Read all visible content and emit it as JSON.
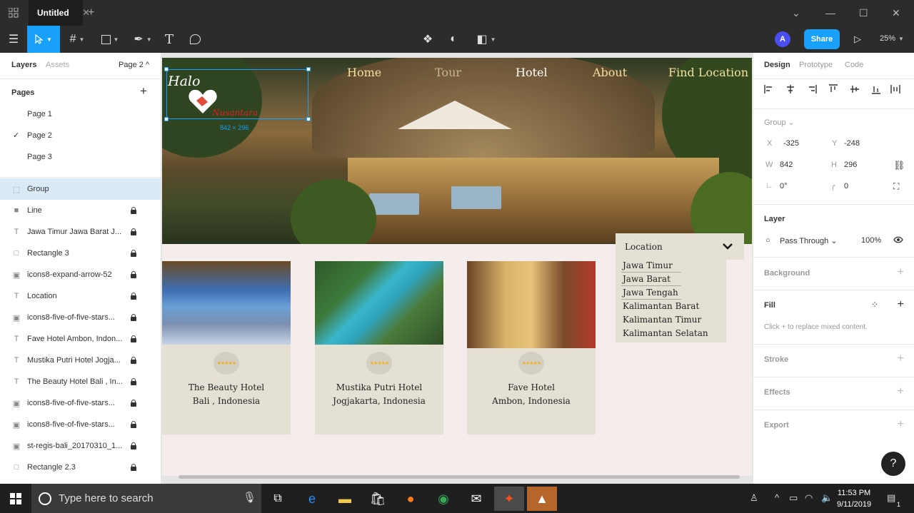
{
  "titlebar": {
    "tab_title": "Untitled",
    "close_glyph": "✕",
    "new_tab_glyph": "+"
  },
  "toolbar": {
    "avatar_initial": "A",
    "share_label": "Share",
    "zoom": "25%"
  },
  "left_panel": {
    "tabs": {
      "layers": "Layers",
      "assets": "Assets",
      "page_selector": "Page 2 ^"
    },
    "pages_title": "Pages",
    "add_glyph": "+",
    "pages": [
      "Page 1",
      "Page 2",
      "Page 3"
    ],
    "selected_page_mark": "✓",
    "layers": [
      {
        "name": "Group",
        "icon": "group-icon",
        "locked": false,
        "selected": true
      },
      {
        "name": "Line",
        "icon": "line-icon",
        "locked": true
      },
      {
        "name": "Jawa Timur Jawa Barat J...",
        "icon": "text-icon",
        "locked": true
      },
      {
        "name": "Rectangle 3",
        "icon": "rectangle-icon",
        "locked": true
      },
      {
        "name": "icons8-expand-arrow-52",
        "icon": "image-icon",
        "locked": true
      },
      {
        "name": "Location",
        "icon": "text-icon",
        "locked": true
      },
      {
        "name": "icons8-five-of-five-stars...",
        "icon": "image-icon",
        "locked": true
      },
      {
        "name": "Fave Hotel Ambon, Indon...",
        "icon": "text-icon",
        "locked": true
      },
      {
        "name": "Mustika Putri Hotel Jogja...",
        "icon": "text-icon",
        "locked": true
      },
      {
        "name": "The Beauty Hotel Bali , In...",
        "icon": "text-icon",
        "locked": true
      },
      {
        "name": "icons8-five-of-five-stars...",
        "icon": "image-icon",
        "locked": true
      },
      {
        "name": "icons8-five-of-five-stars...",
        "icon": "image-icon",
        "locked": true
      },
      {
        "name": "st-regis-bali_20170310_1...",
        "icon": "image-icon",
        "locked": true
      },
      {
        "name": "Rectangle 2.3",
        "icon": "rectangle-icon",
        "locked": true
      }
    ]
  },
  "canvas": {
    "nav": [
      "Home",
      "Tour",
      "Hotel",
      "About",
      "Find Location"
    ],
    "logo": {
      "halo": "Halo",
      "name": "Nusantara"
    },
    "selection_dimensions": "842 × 296",
    "cards": [
      {
        "name": "The Beauty Hotel",
        "location": "Bali , Indonesia",
        "stars": "★★★★★"
      },
      {
        "name": "Mustika Putri Hotel",
        "location": "Jogjakarta, Indonesia",
        "stars": "★★★★★"
      },
      {
        "name": "Fave Hotel",
        "location": "Ambon, Indonesia",
        "stars": "★★★★★"
      }
    ],
    "location": {
      "label": "Location",
      "items": [
        "Jawa Timur",
        "Jawa Barat",
        "Jawa Tengah",
        "Kalimantan Barat",
        "Kalimantan Timur",
        "Kalimantan Selatan"
      ]
    }
  },
  "right_panel": {
    "tabs": {
      "design": "Design",
      "prototype": "Prototype",
      "code": "Code"
    },
    "selection_type": "Group",
    "props": {
      "x_label": "X",
      "x": "-325",
      "y_label": "Y",
      "y": "-248",
      "w_label": "W",
      "w": "842",
      "h_label": "H",
      "h": "296",
      "rotation": "0°",
      "radius": "0"
    },
    "layer_title": "Layer",
    "blend_mode": "Pass Through",
    "opacity": "100%",
    "background_title": "Background",
    "fill_title": "Fill",
    "fill_hint": "Click + to replace mixed content.",
    "stroke_title": "Stroke",
    "effects_title": "Effects",
    "export_title": "Export",
    "help": "?"
  },
  "taskbar": {
    "search_placeholder": "Type here to search",
    "time": "11:53 PM",
    "date": "9/11/2019",
    "notification_count": "1"
  },
  "colors": {
    "accent": "#18a0fb",
    "nav_text": "#f1e1a0",
    "card_bg": "#e4e0d3",
    "frame_bg": "#f5ecec",
    "star": "#f2b01e"
  }
}
